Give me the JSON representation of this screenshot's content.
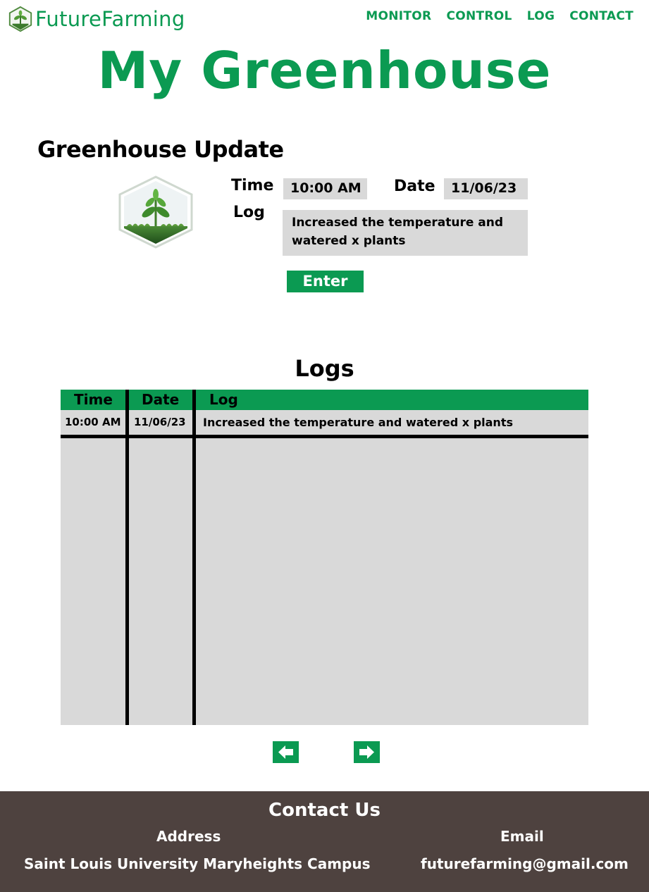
{
  "brand": {
    "name": "FutureFarming",
    "logo_icon": "sprout-hexagon-icon"
  },
  "nav": [
    {
      "label": "MONITOR"
    },
    {
      "label": "CONTROL"
    },
    {
      "label": "LOG"
    },
    {
      "label": "CONTACT"
    }
  ],
  "page_title": "My Greenhouse",
  "update": {
    "title": "Greenhouse Update",
    "illustration": "plant-hexagon-icon",
    "time_label": "Time",
    "time_value": "10:00 AM",
    "date_label": "Date",
    "date_value": "11/06/23",
    "log_label": "Log",
    "log_value": "Increased the temperature and watered x plants",
    "enter_label": "Enter"
  },
  "logs": {
    "title": "Logs",
    "columns": [
      "Time",
      "Date",
      "Log"
    ],
    "rows": [
      {
        "time": "10:00 AM",
        "date": "11/06/23",
        "log": "Increased the temperature and watered x plants"
      }
    ],
    "prev_icon": "arrow-left-icon",
    "next_icon": "arrow-right-icon"
  },
  "footer": {
    "title": "Contact Us",
    "address_label": "Address",
    "address_value": "Saint Louis University Maryheights Campus",
    "email_label": "Email",
    "email_value": "futurefarming@gmail.com"
  },
  "colors": {
    "accent": "#0b9a52",
    "field_bg": "#d9d9d9",
    "footer_bg": "#4e423f"
  }
}
